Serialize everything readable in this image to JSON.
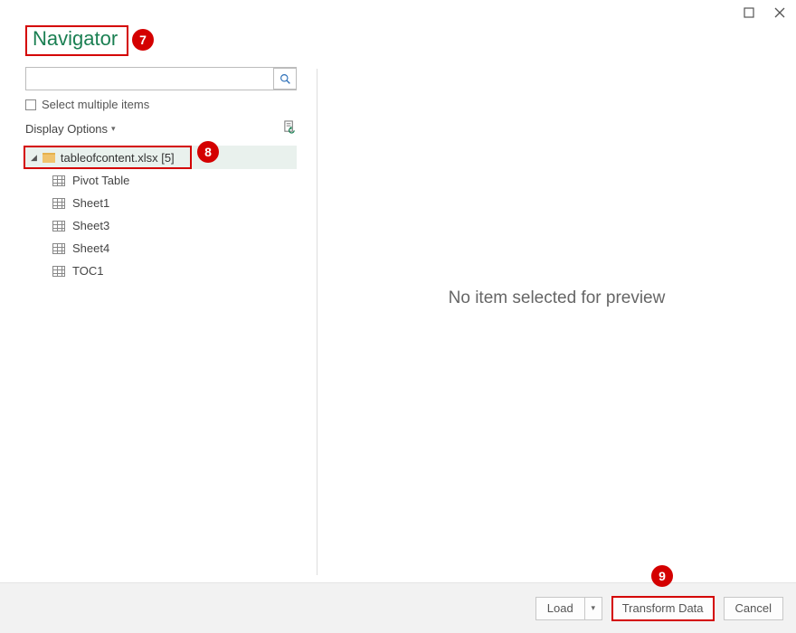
{
  "window": {
    "title": "Navigator",
    "maximize_label": "Maximize",
    "close_label": "Close"
  },
  "search": {
    "placeholder": ""
  },
  "options": {
    "select_multiple": "Select multiple items",
    "display_options": "Display Options"
  },
  "tree": {
    "root_label": "tableofcontent.xlsx [5]",
    "items": [
      {
        "label": "Pivot Table"
      },
      {
        "label": "Sheet1"
      },
      {
        "label": "Sheet3"
      },
      {
        "label": "Sheet4"
      },
      {
        "label": "TOC1"
      }
    ]
  },
  "preview": {
    "empty_message": "No item selected for preview"
  },
  "footer": {
    "load": "Load",
    "transform": "Transform Data",
    "cancel": "Cancel"
  },
  "annotations": {
    "badge7": "7",
    "badge8": "8",
    "badge9": "9"
  }
}
